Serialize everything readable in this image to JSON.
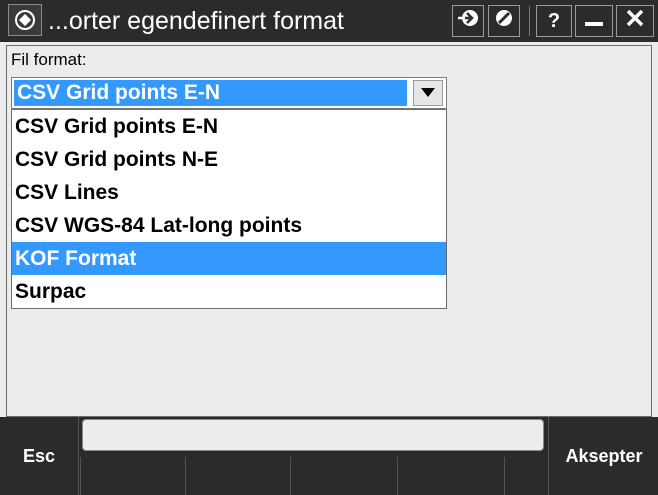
{
  "titlebar": {
    "title": "...orter egendefinert format",
    "app_icon": "trimble-app-icon",
    "buttons": {
      "sync": "sync-arrow-icon",
      "prohibit": "no-entry-icon",
      "help": "?",
      "minimize": "minimize-icon",
      "close": "close-icon"
    }
  },
  "form": {
    "label": "Fil format:",
    "selected_value": "CSV Grid points E-N",
    "options": [
      "CSV Grid points E-N",
      "CSV Grid points N-E",
      "CSV Lines",
      "CSV WGS-84 Lat-long points",
      "KOF Format",
      "Surpac"
    ],
    "highlighted_option": "KOF Format"
  },
  "softkeys": {
    "left": "Esc",
    "right": "Aksepter"
  },
  "colors": {
    "selection": "#3399ff",
    "titlebar": "#2b2b2b",
    "background": "#ececec"
  }
}
